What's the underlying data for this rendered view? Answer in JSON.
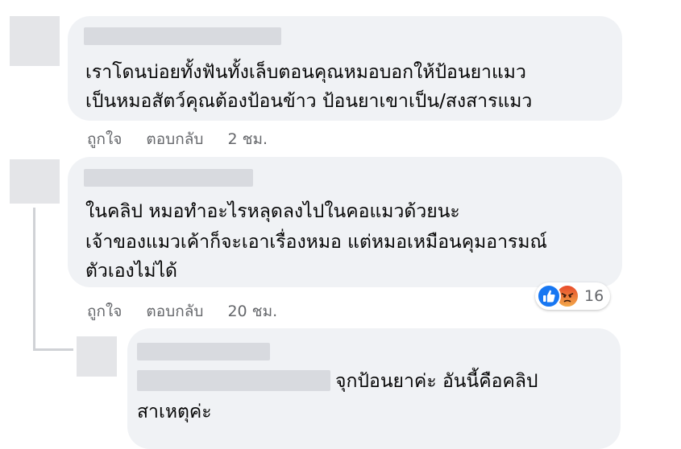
{
  "comments": [
    {
      "lines": [
        "เราโดนบ่อยทั้งฟันทั้งเล็บตอนคุณหมอบอกให้ป้อนยาแมว",
        "เป็นหมอสัตว์คุณต้องป้อนข้าว ป้อนยาเขาเป็น/สงสารแมว"
      ],
      "like": "ถูกใจ",
      "reply": "ตอบกลับ",
      "time": "2 ชม."
    },
    {
      "lines": [
        "ในคลิป หมอทำอะไรหลุดลงไปในคอแมวด้วยนะ",
        "เจ้าของแมวเค้าก็จะเอาเรื่องหมอ แต่หมอเหมือนคุมอารมณ์",
        "ตัวเองไม่ได้"
      ],
      "like": "ถูกใจ",
      "reply": "ตอบกลับ",
      "time": "20 ชม.",
      "reactions": {
        "icons": [
          "like-icon",
          "angry-icon"
        ],
        "count": "16"
      }
    }
  ],
  "reply": {
    "lines": [
      "จุกป้อนยาค่ะ อันนี้คือคลิป",
      "สาเหตุค่ะ"
    ]
  },
  "colors": {
    "bubble": "#f0f2f5",
    "meta_text": "#65676b",
    "like_blue": "#1877f2",
    "angry_orange": "#f0783c"
  }
}
